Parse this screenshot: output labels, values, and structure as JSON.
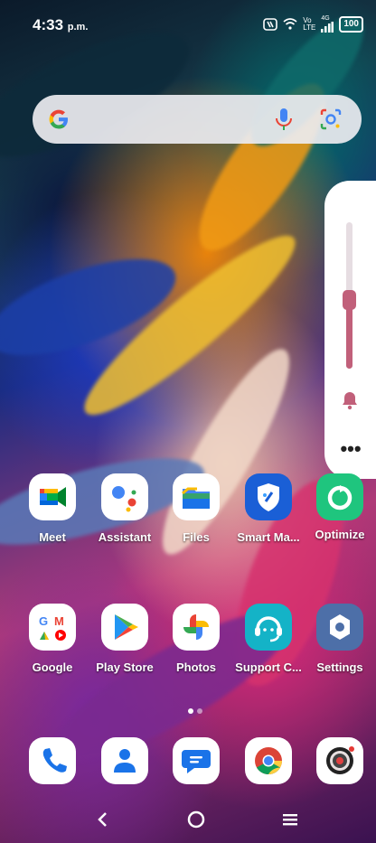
{
  "status": {
    "time": "4:33",
    "ampm": "p.m.",
    "nfc_icon": "nfc-icon",
    "wifi_icon": "wifi-icon",
    "lte_top": "Vo",
    "lte_bottom": "LTE",
    "lte_right": "4G",
    "battery": "100"
  },
  "search": {
    "logo": "google-g-icon",
    "mic": "mic-icon",
    "lens": "lens-icon"
  },
  "volume": {
    "level_fraction": 0.47,
    "bell": "bell-icon",
    "more": "•••"
  },
  "apps_row1": [
    {
      "label": "Meet",
      "icon": "meet-icon"
    },
    {
      "label": "Assistant",
      "icon": "assistant-icon"
    },
    {
      "label": "Files",
      "icon": "files-icon"
    },
    {
      "label": "Smart Ma...",
      "icon": "smart-manager-icon"
    },
    {
      "label": "Optimize",
      "icon": "optimize-icon"
    }
  ],
  "apps_row2": [
    {
      "label": "Google",
      "icon": "google-folder-icon"
    },
    {
      "label": "Play Store",
      "icon": "play-store-icon"
    },
    {
      "label": "Photos",
      "icon": "photos-icon"
    },
    {
      "label": "Support C...",
      "icon": "support-icon"
    },
    {
      "label": "Settings",
      "icon": "settings-icon"
    }
  ],
  "dock": [
    "phone-icon",
    "contacts-icon",
    "messages-icon",
    "chrome-icon",
    "camera-icon"
  ],
  "page_indicator": {
    "pages": 2,
    "current": 1
  },
  "nav": {
    "back": "back-icon",
    "home": "home-icon",
    "recents": "menu-icon"
  },
  "colors": {
    "volume_accent": "#c1607a",
    "search_bg": "#ebebf0"
  }
}
